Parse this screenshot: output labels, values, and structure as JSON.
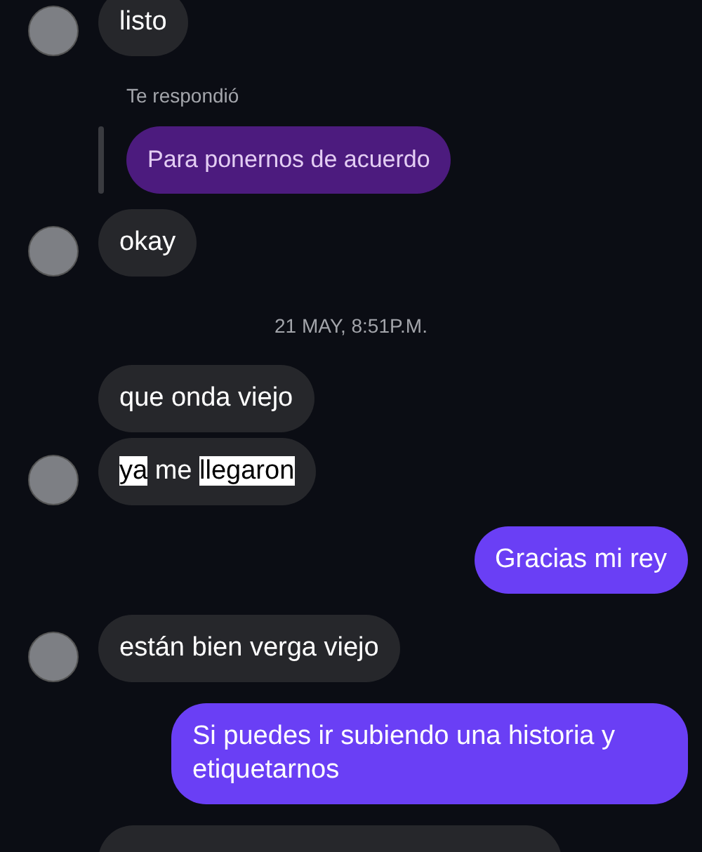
{
  "messages": [
    {
      "kind": "incoming",
      "avatar": true,
      "parts": [
        {
          "text": "listo",
          "highlighted": false
        }
      ]
    },
    {
      "kind": "reply",
      "label": "Te respondió",
      "quote": "Para ponernos de acuerdo"
    },
    {
      "kind": "incoming",
      "avatar": true,
      "parts": [
        {
          "text": "okay",
          "highlighted": false
        }
      ]
    },
    {
      "kind": "timestamp",
      "text": "21 MAY, 8:51P.M."
    },
    {
      "kind": "incoming",
      "avatar": false,
      "parts": [
        {
          "text": "que onda viejo",
          "highlighted": false
        }
      ]
    },
    {
      "kind": "incoming",
      "avatar": true,
      "parts": [
        {
          "text": "ya",
          "highlighted": true
        },
        {
          "text": " me ",
          "highlighted": false
        },
        {
          "text": "llegaron",
          "highlighted": true
        }
      ]
    },
    {
      "kind": "outgoing",
      "parts": [
        {
          "text": "Gracias mi rey",
          "highlighted": false
        }
      ]
    },
    {
      "kind": "incoming",
      "avatar": true,
      "parts": [
        {
          "text": "están bien verga viejo",
          "highlighted": false
        }
      ]
    },
    {
      "kind": "outgoing",
      "parts": [
        {
          "text": "Si puedes ir subiendo una historia y etiquetarnos",
          "highlighted": false
        }
      ]
    },
    {
      "kind": "incoming_cut"
    }
  ]
}
